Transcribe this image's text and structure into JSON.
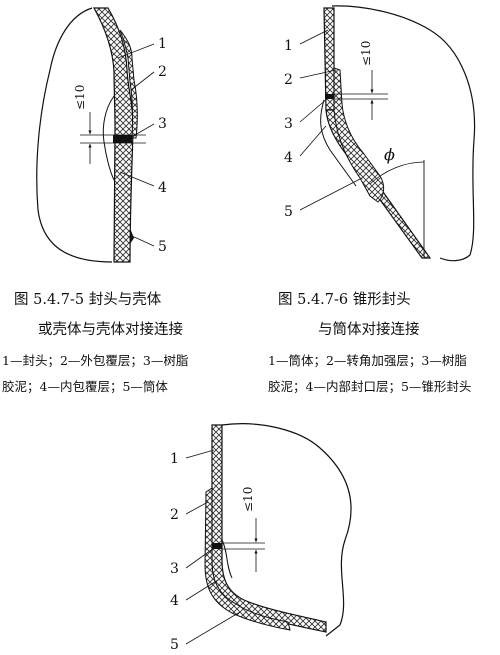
{
  "figures": [
    {
      "callouts": [
        "1",
        "2",
        "3",
        "4",
        "5"
      ],
      "dimension": "≤10",
      "caption_line1": "图 5.4.7-5   封头与壳体",
      "caption_line2": "或壳体与壳体对接连接",
      "legend_line1": "1—封头；2—外包覆层；3—树脂",
      "legend_line2": "胶泥；4—内包覆层；5—筒体"
    },
    {
      "callouts": [
        "1",
        "2",
        "3",
        "4",
        "5"
      ],
      "dimension": "≤10",
      "angle_symbol": "ϕ",
      "caption_line1": "图 5.4.7-6   锥形封头",
      "caption_line2": "与筒体对接连接",
      "legend_line1": "1—筒体；2—转角加强层；3—树脂",
      "legend_line2": "胶泥；4—内部封口层；5—锥形封头"
    },
    {
      "callouts": [
        "1",
        "2",
        "3",
        "4",
        "5"
      ],
      "dimension": "≤10"
    }
  ],
  "colors": {
    "ink": "#111111",
    "hatch": "#333333",
    "background": "#ffffff"
  }
}
